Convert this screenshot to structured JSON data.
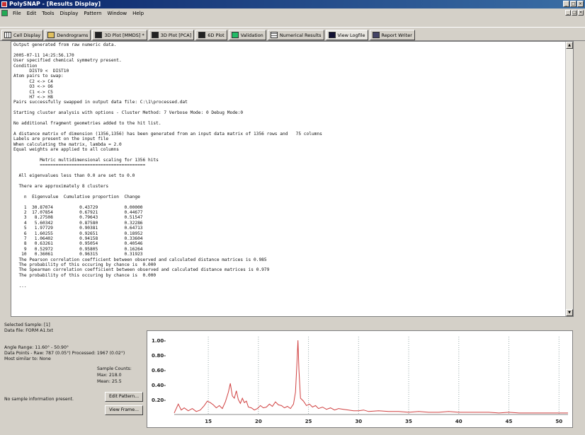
{
  "window": {
    "title": "PolySNAP - [Results Display]"
  },
  "menu": [
    "File",
    "Edit",
    "Tools",
    "Display",
    "Pattern",
    "Window",
    "Help"
  ],
  "tabs": [
    {
      "label": "Cell Display",
      "icon": "grid-icon"
    },
    {
      "label": "Dendrograms",
      "icon": "dendrogram-icon"
    },
    {
      "label": "3D Plot [MMDS] *",
      "icon": "3d-plot-icon"
    },
    {
      "label": "3D Plot [PCA]",
      "icon": "3d-plot-icon"
    },
    {
      "label": "6D Plot",
      "icon": "6d-plot-icon"
    },
    {
      "label": "Validation",
      "icon": "validation-icon"
    },
    {
      "label": "Numerical Results",
      "icon": "table-icon"
    },
    {
      "label": "View Logfile",
      "icon": "logfile-icon",
      "active": true
    },
    {
      "label": "Report Writer",
      "icon": "report-icon"
    }
  ],
  "log": {
    "lines": [
      "Output generated from raw numeric data.",
      "",
      "2005-07-11 14:25:56.170",
      "User specified chemical symmetry present.",
      "Condition",
      "      DIST9 <  DIST10",
      "Atom pairs to swap:",
      "      C2 <-> C4",
      "      O3 <-> O6",
      "      C1 <-> C5",
      "      H7 <-> H8",
      "Pairs successfully swapped in output data file: C:\\1\\processed.dat",
      "",
      "Starting cluster analysis with options - Cluster Method: 7 Verbose Mode: 0 Debug Mode:0",
      "",
      "No additional fragment geometries added to the hit list.",
      "",
      "A distance matrix of dimension (1356,1356) has been generated from an input data matrix of 1356 rows and   75 columns",
      "Labels are present on the input file",
      "When calculating the matrix, lambda = 2.0",
      "Equal weights are applied to all columns",
      "",
      "          Metric multidimensional scaling for 1356 hits",
      "          ========================================",
      "",
      "  All eigenvalues less than 0.0 are set to 0.0",
      "",
      "  There are approximately 8 clusters",
      "",
      "    n  Eigenvalue  Cumulative proportion  Change",
      "",
      "    1  30.87074          0.43729          0.00000",
      "    2  17.07854          0.67921          0.44677",
      "    3   8.27508          0.79643          0.51547",
      "    4   5.60342          0.87580          0.32286",
      "    5   1.97729          0.90381          0.64713",
      "    6   1.60255          0.92651          0.18952",
      "    7   1.06402          0.94158          0.33604",
      "    8   0.63261          0.95054          0.40546",
      "    9   0.52972          0.95805          0.16264",
      "   10   0.36061          0.96315          0.31923",
      "  The Pearson correlation coefficient between observed and calculated distance matrices is 0.985",
      "  The probability of this occuring by chance is  0.000",
      "  The Spearman correlation coefficient between observed and calculated distance matrices is 0.979",
      "  The probability of this occuring by chance is  0.000",
      "",
      "  ..."
    ]
  },
  "sample": {
    "selected": "Selected Sample: [1]",
    "data_file": "Data file:  FORM A1.txt",
    "angle_range": "Angle Range:       11.60° - 50.90°",
    "data_points": "Data Points - Raw: 787 (0.05°)   Processed: 1967 (0.02°)",
    "most_similar": "Most similar to: None",
    "counts_label": "Sample Counts:",
    "max": "Max:  218.0",
    "mean": "Mean: 25.5",
    "no_info": "No sample information present.",
    "edit_button": "Edit Pattern...",
    "view_button": "View Frame..."
  },
  "chart_data": {
    "type": "line",
    "x_ticks": [
      "15",
      "20",
      "25",
      "30",
      "35",
      "40",
      "45",
      "50"
    ],
    "y_ticks": [
      "1.00-",
      "0.80-",
      "0.60-",
      "0.40-",
      "0.20-"
    ],
    "xlim": [
      11.6,
      50.9
    ],
    "ylim": [
      0,
      1.05
    ],
    "grid": "vertical dotted",
    "line_color": "#d04040",
    "x": [
      11.6,
      12.0,
      12.3,
      12.6,
      13.0,
      13.4,
      13.8,
      14.2,
      14.6,
      14.9,
      15.2,
      15.5,
      15.8,
      16.1,
      16.4,
      16.7,
      17.0,
      17.2,
      17.4,
      17.6,
      17.8,
      18.0,
      18.2,
      18.4,
      18.6,
      18.8,
      19.0,
      19.3,
      19.6,
      19.9,
      20.2,
      20.5,
      20.8,
      21.1,
      21.4,
      21.7,
      22.0,
      22.3,
      22.6,
      22.9,
      23.2,
      23.5,
      23.7,
      23.85,
      23.95,
      24.05,
      24.2,
      24.5,
      24.8,
      25.1,
      25.4,
      25.7,
      26.0,
      26.4,
      26.8,
      27.2,
      27.6,
      28.0,
      28.5,
      29.0,
      29.5,
      30.0,
      30.5,
      31.0,
      32.0,
      33.0,
      34.0,
      35.0,
      36.0,
      37.0,
      38.0,
      39.0,
      40.0,
      41.0,
      42.0,
      43.0,
      44.0,
      45.0,
      46.0,
      47.0,
      48.0,
      49.0,
      50.0,
      50.9
    ],
    "y": [
      0.02,
      0.14,
      0.06,
      0.09,
      0.05,
      0.08,
      0.04,
      0.06,
      0.12,
      0.18,
      0.16,
      0.13,
      0.09,
      0.12,
      0.08,
      0.17,
      0.3,
      0.42,
      0.25,
      0.22,
      0.32,
      0.2,
      0.15,
      0.22,
      0.16,
      0.18,
      0.1,
      0.09,
      0.06,
      0.08,
      0.12,
      0.09,
      0.1,
      0.14,
      0.11,
      0.17,
      0.13,
      0.12,
      0.09,
      0.11,
      0.08,
      0.14,
      0.3,
      0.7,
      1.0,
      0.6,
      0.22,
      0.18,
      0.12,
      0.14,
      0.1,
      0.12,
      0.08,
      0.1,
      0.07,
      0.09,
      0.06,
      0.08,
      0.07,
      0.06,
      0.05,
      0.05,
      0.06,
      0.04,
      0.05,
      0.04,
      0.04,
      0.03,
      0.04,
      0.03,
      0.03,
      0.04,
      0.03,
      0.03,
      0.03,
      0.03,
      0.02,
      0.03,
      0.02,
      0.02,
      0.02,
      0.02,
      0.02,
      0.02
    ]
  }
}
